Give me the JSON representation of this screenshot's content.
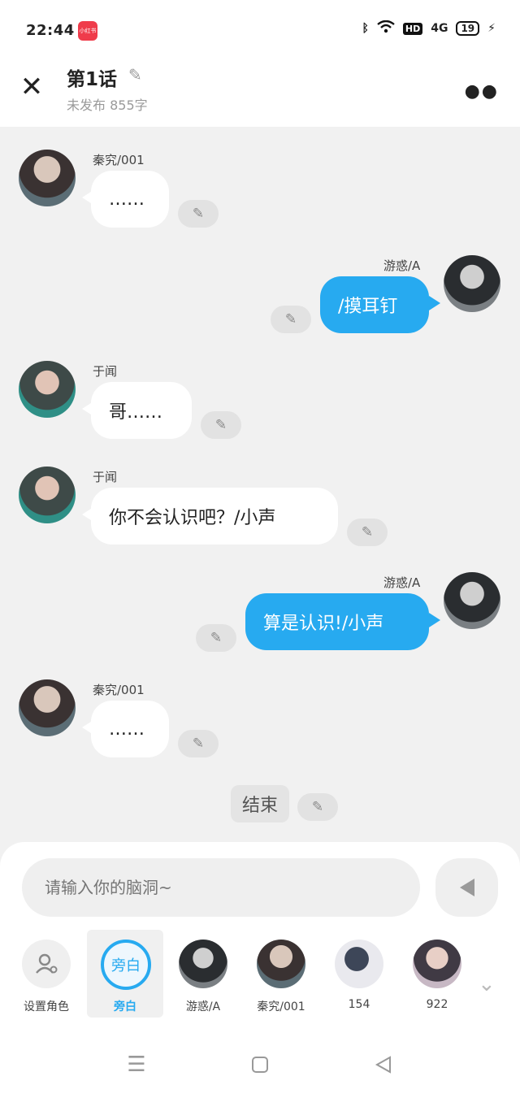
{
  "status_bar": {
    "time": "22:44",
    "app_icon": "小红书",
    "hd": "HD",
    "network": "4G",
    "battery": "19"
  },
  "header": {
    "title": "第1话",
    "subtitle": "未发布 855字"
  },
  "messages": [
    {
      "name": "秦究/001",
      "text": "……"
    },
    {
      "name": "游惑/A",
      "text": "/摸耳钉"
    },
    {
      "name": "于闻",
      "text": "哥……"
    },
    {
      "name": "于闻",
      "text": "你不会认识吧？/小声"
    },
    {
      "name": "游惑/A",
      "text": "算是认识!/小声"
    },
    {
      "name": "秦究/001",
      "text": "……"
    }
  ],
  "narration": {
    "text": "结束"
  },
  "composer": {
    "placeholder": "请输入你的脑洞~"
  },
  "roles": [
    {
      "label": "设置角色"
    },
    {
      "label": "旁白",
      "badge": "旁白"
    },
    {
      "label": "游惑/A"
    },
    {
      "label": "秦究/001"
    },
    {
      "label": "154"
    },
    {
      "label": "922"
    }
  ],
  "colors": {
    "accent": "#27aaf0",
    "bubble_left": "#ffffff",
    "background": "#f1f1f1"
  },
  "icons": {
    "close": "close-icon",
    "edit": "pencil-icon",
    "more": "more-icon",
    "send": "send-icon",
    "expand": "chevron-down-icon"
  }
}
